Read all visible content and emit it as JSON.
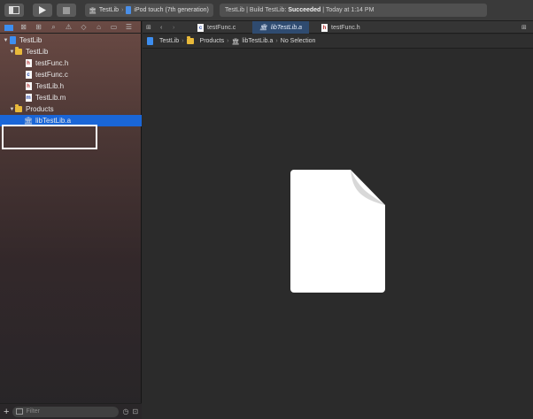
{
  "toolbar": {
    "scheme_name": "TestLib",
    "device_name": "iPod touch (7th generation)",
    "status_prefix": "TestLib | Build TestLib:",
    "status_result": "Succeeded",
    "status_time": "| Today at 1:14 PM"
  },
  "navigator": {
    "items": [
      {
        "label": "TestLib",
        "type": "project"
      },
      {
        "label": "TestLib",
        "type": "folder"
      },
      {
        "label": "testFunc.h",
        "type": "h-file"
      },
      {
        "label": "testFunc.c",
        "type": "c-file"
      },
      {
        "label": "TestLib.h",
        "type": "h-file"
      },
      {
        "label": "TestLib.m",
        "type": "m-file"
      },
      {
        "label": "Products",
        "type": "folder"
      },
      {
        "label": "libTestLib.a",
        "type": "library"
      }
    ],
    "filter_placeholder": "Filter"
  },
  "tabs": [
    {
      "label": "testFunc.c",
      "active": false
    },
    {
      "label": "libTestLib.a",
      "active": true
    },
    {
      "label": "testFunc.h",
      "active": false
    }
  ],
  "jumpbar": {
    "project": "TestLib",
    "group": "Products",
    "file": "libTestLib.a",
    "selection": "No Selection"
  },
  "colors": {
    "selection": "#1a66d8",
    "active_tab": "#2f4b70",
    "folder": "#e8b93a"
  }
}
